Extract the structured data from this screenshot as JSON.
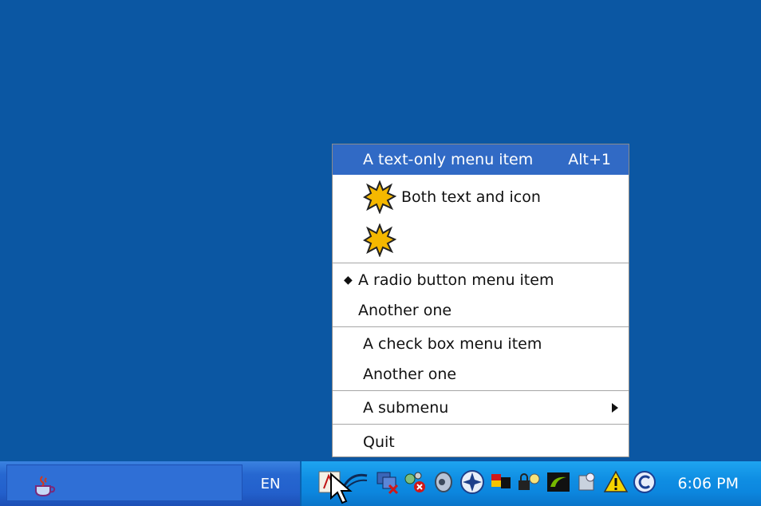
{
  "menu": {
    "text_only": {
      "label": "A text-only menu item",
      "accel": "Alt+1"
    },
    "both": {
      "label": "Both text and icon",
      "icon": "star-burst-icon"
    },
    "icon_only": {
      "icon": "star-burst-icon"
    },
    "radio1": {
      "label": "A radio button menu item",
      "selected": true
    },
    "radio2": {
      "label": "Another one"
    },
    "check1": {
      "label": "A check box menu item"
    },
    "check2": {
      "label": "Another one"
    },
    "submenu": {
      "label": "A submenu"
    },
    "quit": {
      "label": "Quit"
    }
  },
  "taskbar": {
    "language": "EN",
    "clock": "6:06 PM"
  },
  "colors": {
    "desktop": "#0b57a3",
    "menu_highlight": "#316ac5",
    "star_fill": "#f5b800"
  }
}
